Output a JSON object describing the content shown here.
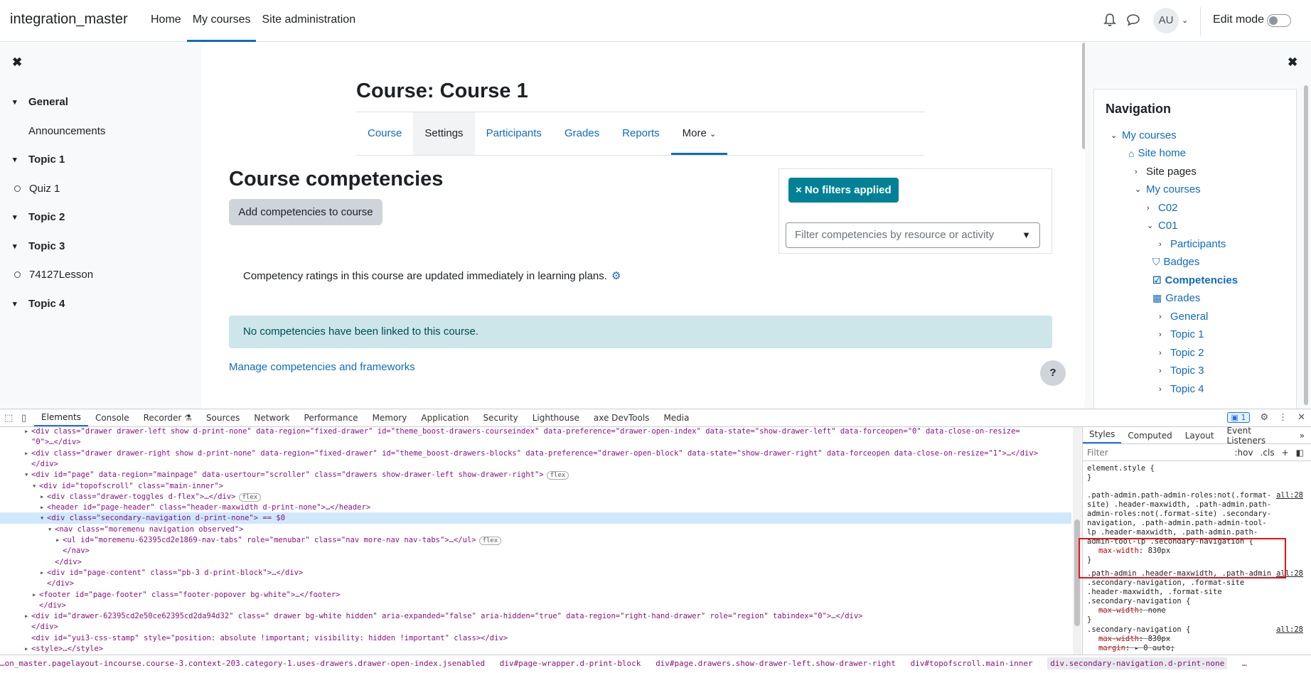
{
  "navbar": {
    "brand": "integration_master",
    "links": [
      "Home",
      "My courses",
      "Site administration"
    ],
    "avatar": "AU",
    "edit_mode": "Edit mode"
  },
  "left_drawer": {
    "close": "✖",
    "items": [
      {
        "type": "section",
        "label": "General"
      },
      {
        "type": "activity-indent",
        "label": "Announcements"
      },
      {
        "type": "section",
        "label": "Topic 1"
      },
      {
        "type": "activity",
        "label": "Quiz 1"
      },
      {
        "type": "section",
        "label": "Topic 2"
      },
      {
        "type": "section",
        "label": "Topic 3"
      },
      {
        "type": "activity",
        "label": "74127Lesson"
      },
      {
        "type": "section",
        "label": "Topic 4"
      }
    ]
  },
  "main": {
    "course_title": "Course: Course 1",
    "tabs": [
      "Course",
      "Settings",
      "Participants",
      "Grades",
      "Reports",
      "More"
    ],
    "heading": "Course competencies",
    "add_button": "Add competencies to course",
    "no_filters": "× No filters applied",
    "filter_placeholder": "Filter competencies by resource or activity",
    "filter_arrow": "▼",
    "ratings_text": "Competency ratings in this course are updated immediately in learning plans.",
    "alert": "No competencies have been linked to this course.",
    "manage_link": "Manage competencies and frameworks",
    "help": "?"
  },
  "right_drawer": {
    "close": "✖",
    "title": "Navigation",
    "tree": [
      {
        "label": "My courses",
        "chevron": "down"
      },
      {
        "label": "Site home",
        "icon": "home-icon"
      },
      {
        "label": "Site pages",
        "chevron": "right"
      },
      {
        "label": "My courses",
        "chevron": "down"
      },
      {
        "label": "C02",
        "chevron": "right"
      },
      {
        "label": "C01",
        "chevron": "down"
      },
      {
        "label": "Participants",
        "chevron": "right"
      },
      {
        "label": "Badges",
        "icon": "shield-icon"
      },
      {
        "label": "Competencies",
        "icon": "check-square-icon"
      },
      {
        "label": "Grades",
        "icon": "table-icon"
      },
      {
        "label": "General",
        "chevron": "right"
      },
      {
        "label": "Topic 1",
        "chevron": "right"
      },
      {
        "label": "Topic 2",
        "chevron": "right"
      },
      {
        "label": "Topic 3",
        "chevron": "right"
      },
      {
        "label": "Topic 4",
        "chevron": "right"
      }
    ]
  },
  "devtools": {
    "tabs": [
      "Elements",
      "Console",
      "Recorder ⚗",
      "Sources",
      "Network",
      "Performance",
      "Memory",
      "Application",
      "Security",
      "Lighthouse",
      "axe DevTools",
      "Media"
    ],
    "issues_badge": "1",
    "dom_lines": [
      {
        "indent": 2,
        "tri": "▸",
        "text": "<div class=\"drawer drawer-left show d-print-none\" data-region=\"fixed-drawer\" id=\"theme_boost-drawers-courseindex\" data-preference=\"drawer-open-index\" data-state=\"show-drawer-left\" data-forceopen=\"0\" data-close-on-resize="
      },
      {
        "indent": 2,
        "tri": "",
        "text": "\"0\">…</div>"
      },
      {
        "indent": 2,
        "tri": "▸",
        "text": "<div class=\"drawer drawer-right show d-print-none\" data-region=\"fixed-drawer\" id=\"theme_boost-drawers-blocks\" data-preference=\"drawer-open-block\" data-state=\"show-drawer-right\" data-forceopen data-close-on-resize=\"1\">…</div>"
      },
      {
        "indent": 2,
        "tri": "",
        "text": "</div>"
      },
      {
        "indent": 2,
        "tri": "▾",
        "text": "<div id=\"page\" data-region=\"mainpage\" data-usertour=\"scroller\" class=\"drawers show-drawer-left show-drawer-right\">",
        "badge": "flex"
      },
      {
        "indent": 3,
        "tri": "▾",
        "text": "<div id=\"topofscroll\" class=\"main-inner\">"
      },
      {
        "indent": 4,
        "tri": "▸",
        "text": "<div class=\"drawer-toggles d-flex\">…</div>",
        "badge": "flex"
      },
      {
        "indent": 4,
        "tri": "▸",
        "text": "<header id=\"page-header\" class=\"header-maxwidth d-print-none\">…</header>"
      },
      {
        "indent": 4,
        "tri": "▾",
        "text": "<div class=\"secondary-navigation d-print-none\"> == $0",
        "selected": true
      },
      {
        "indent": 5,
        "tri": "▾",
        "text": "<nav class=\"moremenu navigation observed\">"
      },
      {
        "indent": 6,
        "tri": "▸",
        "text": "<ul id=\"moremenu-62395cd2e1869-nav-tabs\" role=\"menubar\" class=\"nav more-nav nav-tabs\">…</ul>",
        "badge": "flex"
      },
      {
        "indent": 6,
        "tri": "",
        "text": "</nav>"
      },
      {
        "indent": 5,
        "tri": "",
        "text": "</div>"
      },
      {
        "indent": 4,
        "tri": "▸",
        "text": "<div id=\"page-content\" class=\"pb-3 d-print-block\">…</div>"
      },
      {
        "indent": 4,
        "tri": "",
        "text": "</div>"
      },
      {
        "indent": 3,
        "tri": "▸",
        "text": "<footer id=\"page-footer\" class=\"footer-popover bg-white\">…</footer>"
      },
      {
        "indent": 3,
        "tri": "",
        "text": "</div>"
      },
      {
        "indent": 2,
        "tri": "▸",
        "text": "<div id=\"drawer-62395cd2e50ce62395cd2da94d32\" class=\" drawer bg-white hidden\" aria-expanded=\"false\" aria-hidden=\"true\" data-region=\"right-hand-drawer\" role=\"region\" tabindex=\"0\">…</div>"
      },
      {
        "indent": 2,
        "tri": "",
        "text": "</div>"
      },
      {
        "indent": 2,
        "tri": "",
        "text": "<div id=\"yui3-css-stamp\" style=\"position: absolute !important; visibility: hidden !important\" class></div>"
      },
      {
        "indent": 2,
        "tri": "▸",
        "text": "<style>…</style>"
      }
    ],
    "styles_tabs": [
      "Styles",
      "Computed",
      "Layout",
      "Event Listeners",
      "»"
    ],
    "filter_placeholder": "Filter",
    "filter_hov": ":hov",
    "filter_cls": ".cls",
    "filter_plus": "+",
    "rules": [
      {
        "sel": "element.style {",
        "body": [],
        "close": "}",
        "src": ""
      },
      {
        "sel": ".path-admin.path-admin-roles:not(.format-site) .header-maxwidth, .path-admin.path-admin-roles:not(.format-site) .secondary-navigation, .path-admin.path-admin-tool-lp .header-maxwidth, .path-admin.path-admin-tool-lp .secondary-navigation {",
        "body": [
          {
            "prop": "max-width",
            "val": "830px",
            "strike": false
          }
        ],
        "close": "}",
        "src": "all:28"
      },
      {
        "sel": ".path-admin .header-maxwidth, .path-admin .secondary-navigation, .format-site .header-maxwidth, .format-site .secondary-navigation {",
        "body": [
          {
            "prop": "max-width",
            "val": "none",
            "strike": true
          }
        ],
        "close": "}",
        "src": "all:28"
      },
      {
        "sel": ".secondary-navigation {",
        "body": [
          {
            "prop": "max-width",
            "val": "830px",
            "strike": true
          },
          {
            "prop": "margin",
            "val": "▸ 0 auto;",
            "strike": true
          }
        ],
        "close": "",
        "src": "all:28"
      }
    ],
    "breadcrumbs": [
      "…on_master.pagelayout-incourse.course-3.context-203.category-1.uses-drawers.drawer-open-index.jsenabled",
      "div#page-wrapper.d-print-block",
      "div#page.drawers.show-drawer-left.show-drawer-right",
      "div#topofscroll.main-inner",
      "div.secondary-navigation.d-print-none"
    ],
    "breadcrumb_more": "…"
  }
}
